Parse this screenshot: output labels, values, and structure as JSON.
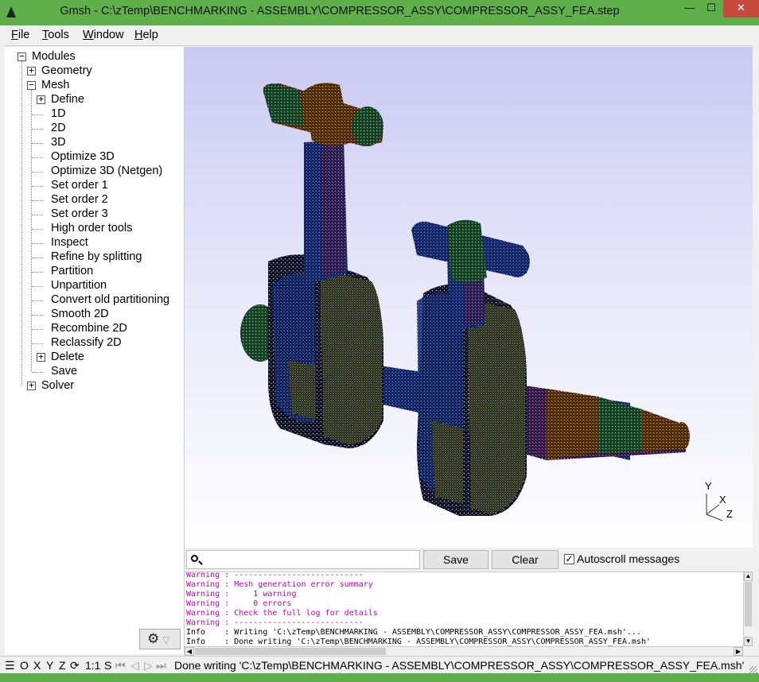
{
  "window": {
    "title": "Gmsh - C:\\zTemp\\BENCHMARKING - ASSEMBLY\\COMPRESSOR_ASSY\\COMPRESSOR_ASSY_FEA.step",
    "minimize_glyph": "—",
    "maximize_glyph": "☐",
    "close_glyph": "✕"
  },
  "menubar": {
    "file": "File",
    "tools": "Tools",
    "window": "Window",
    "help": "Help"
  },
  "tree": {
    "modules": "Modules",
    "geometry": "Geometry",
    "mesh": "Mesh",
    "define": "Define",
    "items": [
      "1D",
      "2D",
      "3D",
      "Optimize 3D",
      "Optimize 3D (Netgen)",
      "Set order 1",
      "Set order 2",
      "Set order 3",
      "High order tools",
      "Inspect",
      "Refine by splitting",
      "Partition",
      "Unpartition",
      "Convert old partitioning",
      "Smooth 2D",
      "Recombine 2D",
      "Reclassify 2D"
    ],
    "delete": "Delete",
    "save": "Save",
    "solver": "Solver",
    "expand_glyph": "+",
    "collapse_glyph": "−"
  },
  "viewport": {
    "axis_labels": {
      "y": "Y",
      "x": "X",
      "z": "Z"
    }
  },
  "messages": {
    "search_placeholder": "",
    "save_label": "Save",
    "clear_label": "Clear",
    "autoscroll_label": "Autoscroll messages",
    "autoscroll_checked": true,
    "check_glyph": "✓",
    "lines": [
      {
        "level": "warn",
        "text": "Warning : ---------------------------"
      },
      {
        "level": "warn",
        "text": "Warning : Mesh generation error summary"
      },
      {
        "level": "warn",
        "text": "Warning :     1 warning"
      },
      {
        "level": "warn",
        "text": "Warning :     0 errors"
      },
      {
        "level": "warn",
        "text": "Warning : Check the full log for details"
      },
      {
        "level": "warn",
        "text": "Warning : ---------------------------"
      },
      {
        "level": "info",
        "text": "Info    : Writing 'C:\\zTemp\\BENCHMARKING - ASSEMBLY\\COMPRESSOR_ASSY\\COMPRESSOR_ASSY_FEA.msh'..."
      },
      {
        "level": "info",
        "text": "Info    : Done writing 'C:\\zTemp\\BENCHMARKING - ASSEMBLY\\COMPRESSOR_ASSY\\COMPRESSOR_ASSY_FEA.msh'"
      }
    ]
  },
  "statusbar": {
    "menu_glyph": "☰",
    "o": "O",
    "x": "X",
    "y": "Y",
    "z": "Z",
    "rotate_glyph": "⟳",
    "scale": "1:1",
    "s": "S",
    "first_glyph": "⏮",
    "prev_glyph": "◁",
    "play_glyph": "▷",
    "last_glyph": "⏭",
    "status_text": "Done writing 'C:\\zTemp\\BENCHMARKING - ASSEMBLY\\COMPRESSOR_ASSY\\COMPRESSOR_ASSY_FEA.msh'"
  },
  "gear": {
    "gear_glyph": "⚙",
    "arrow_glyph": "▽"
  },
  "colors": {
    "titlebar": "#5fb04a",
    "close_button": "#c74a3d",
    "warning_text": "#c000c0",
    "viewport_top": "#c9c9f3",
    "viewport_bottom": "#ffffff"
  },
  "icons": {
    "app": "gmsh-triangle-icon",
    "search": "magnifier-icon",
    "gear": "gear-icon"
  }
}
